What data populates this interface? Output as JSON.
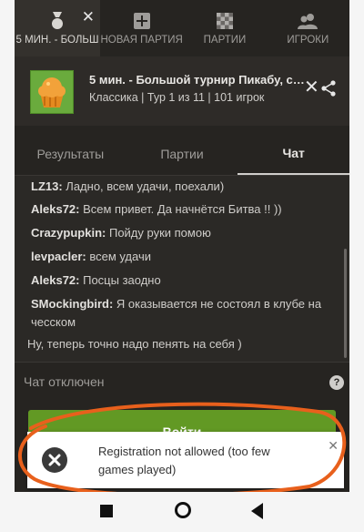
{
  "top_tabs": [
    {
      "label": "5 МИН. - БОЛЬШ",
      "icon": "medal-icon"
    },
    {
      "label": "НОВАЯ ПАРТИЯ",
      "icon": "plus-box-icon"
    },
    {
      "label": "ПАРТИИ",
      "icon": "chessboard-icon"
    },
    {
      "label": "ИГРОКИ",
      "icon": "players-icon"
    }
  ],
  "tournament": {
    "title": "5 мин. - Большой турнир Пикабу, се...",
    "subtitle": "Классика | Тур 1 из 11 | 101 игрок"
  },
  "sub_tabs": [
    {
      "label": "Результаты"
    },
    {
      "label": "Партии"
    },
    {
      "label": "Чат"
    }
  ],
  "chat": {
    "messages": [
      {
        "user": "LZ13:",
        "text": "Ладно, всем удачи, поехали)"
      },
      {
        "user": "Aleks72:",
        "text": "Всем привет. Да начнётся Битва !! ))"
      },
      {
        "user": "Crazypupkin:",
        "text": "Пойду руки помою"
      },
      {
        "user": "levpacler:",
        "text": "всем удачи"
      },
      {
        "user": "Aleks72:",
        "text": "Посцы заодно"
      },
      {
        "user": "SMockingbird:",
        "text": "Я оказывается не состоял в клубе на чесском"
      },
      {
        "user": "",
        "text": "Ну, теперь точно надо пенять на себя )"
      }
    ],
    "disabled_label": "Чат отключен"
  },
  "join_button": {
    "label": "Войти"
  },
  "toast": {
    "message": "Registration not allowed (too few games played)"
  },
  "colors": {
    "background": "#262421",
    "accent_green": "#629924",
    "annotation": "#e8601c"
  }
}
